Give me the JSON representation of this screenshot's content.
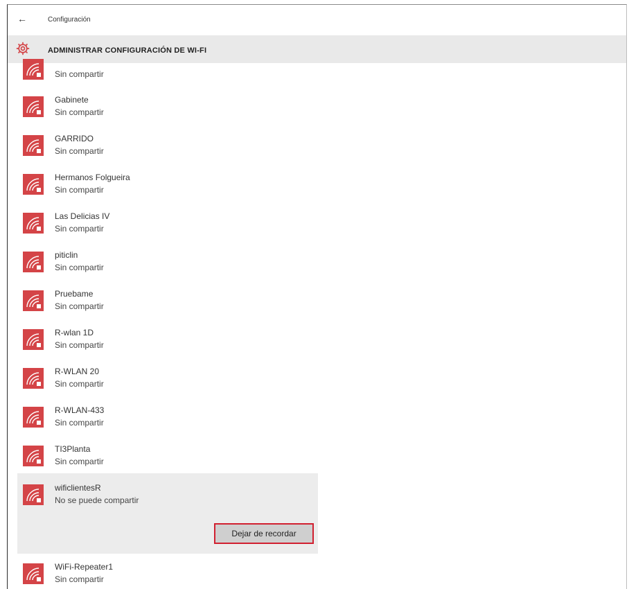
{
  "window": {
    "title": "Configuración",
    "back_icon": "←"
  },
  "header": {
    "title": "ADMINISTRAR CONFIGURACIÓN DE WI-FI",
    "accent": "#d44447"
  },
  "networks": [
    {
      "name": "",
      "status": "Sin compartir"
    },
    {
      "name": "Gabinete",
      "status": "Sin compartir"
    },
    {
      "name": "GARRIDO",
      "status": "Sin compartir"
    },
    {
      "name": "Hermanos Folgueira",
      "status": "Sin compartir"
    },
    {
      "name": "Las Delicias IV",
      "status": "Sin compartir"
    },
    {
      "name": "piticlin",
      "status": "Sin compartir"
    },
    {
      "name": "Pruebame",
      "status": "Sin compartir"
    },
    {
      "name": "R-wlan 1D",
      "status": "Sin compartir"
    },
    {
      "name": "R-WLAN 20",
      "status": "Sin compartir"
    },
    {
      "name": "R-WLAN-433",
      "status": "Sin compartir"
    },
    {
      "name": "TI3Planta",
      "status": "Sin compartir"
    },
    {
      "name": "wificlientesR",
      "status": "No se puede compartir"
    },
    {
      "name": "WiFi-Repeater1",
      "status": "Sin compartir"
    }
  ],
  "selected_network": {
    "action_label": "Dejar de recordar"
  },
  "icons": {
    "network": "wifi-icon",
    "settings": "gear-icon"
  }
}
